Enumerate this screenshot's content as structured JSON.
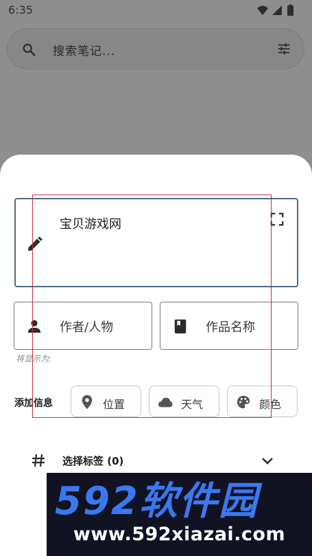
{
  "status_bar": {
    "time": "6:35"
  },
  "search": {
    "placeholder": "搜索笔记..."
  },
  "note": {
    "text": "宝贝游戏网"
  },
  "fields": {
    "author": "作者/人物",
    "work": "作品名称"
  },
  "hint": "将显示为:",
  "info": {
    "label": "添加信息",
    "chips": {
      "location": "位置",
      "weather": "天气",
      "color": "颜色"
    }
  },
  "tags": {
    "label": "选择标签 (0)"
  },
  "watermark": {
    "logo": "592软件园",
    "url": "www.592xiazai.com"
  },
  "colors": {
    "focus_border": "#4a6a8a",
    "overlay": "#c0303a",
    "watermark_bg": "#111322",
    "logo_blue": "#3b78f0"
  },
  "icons": [
    "search-icon",
    "filter-icon",
    "pencil-icon",
    "fullscreen-icon",
    "person-icon",
    "book-icon",
    "location-pin-icon",
    "cloud-icon",
    "palette-icon",
    "hash-icon",
    "chevron-down-icon"
  ]
}
